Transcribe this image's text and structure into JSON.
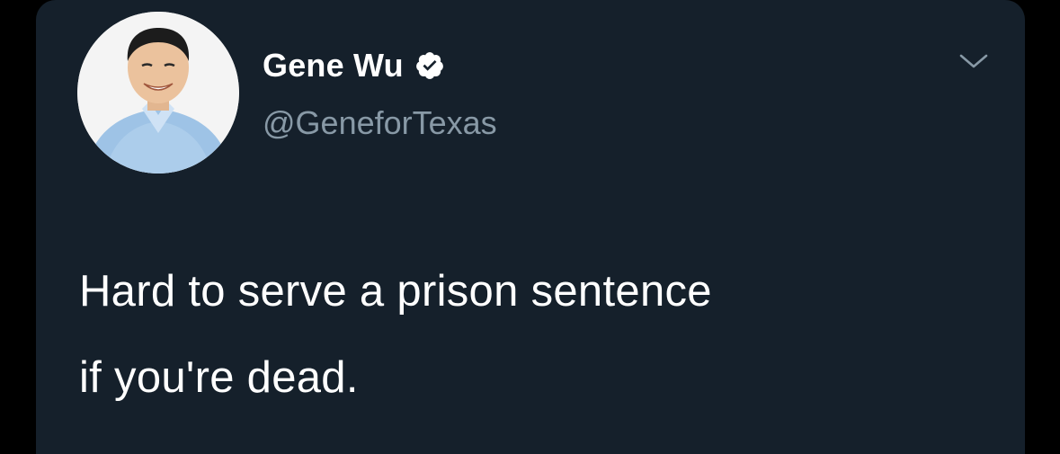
{
  "tweet": {
    "author": {
      "display_name": "Gene Wu",
      "handle": "@GeneforTexas",
      "verified": true
    },
    "text_lines": [
      "Hard to serve a prison sentence",
      "if you're dead."
    ]
  },
  "colors": {
    "page_background": "#000000",
    "card_background": "#15202b",
    "primary_text": "#ffffff",
    "secondary_text": "#8899a6",
    "verified_badge": "#ffffff"
  },
  "icons": {
    "verified": "verified-badge-icon",
    "menu": "chevron-down-icon"
  }
}
